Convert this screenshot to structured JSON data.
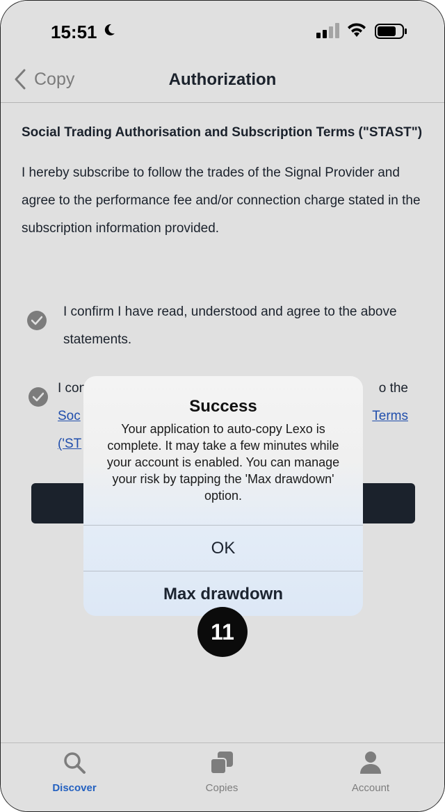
{
  "status_bar": {
    "time": "15:51"
  },
  "nav": {
    "back_label": "Copy",
    "title": "Authorization"
  },
  "content": {
    "heading": "Social Trading Authorisation and Subscription Terms (\"STAST\")",
    "intro": "I hereby subscribe to follow the trades of the Signal Provider and agree to the performance fee and/or connection charge stated in the subscription information provided.",
    "checkbox1_text": "I confirm I have read, understood and agree to the above statements.",
    "checkbox2_line1_start": "I con",
    "checkbox2_line1_end": "o the",
    "checkbox2_link_start": "Soc",
    "checkbox2_link_end": "Terms",
    "checkbox2_line3_start": "('ST"
  },
  "modal": {
    "title": "Success",
    "message": "Your application to auto-copy Lexo is complete. It may take a few minutes while your account is enabled. You can manage your risk by tapping the 'Max drawdown' option.",
    "ok_label": "OK",
    "max_drawdown_label": "Max drawdown"
  },
  "step_badge": "11",
  "tabbar": {
    "tabs": [
      {
        "label": "Discover",
        "icon": "search-icon",
        "active": true
      },
      {
        "label": "Copies",
        "icon": "copies-icon",
        "active": false
      },
      {
        "label": "Account",
        "icon": "person-icon",
        "active": false
      }
    ]
  },
  "colors": {
    "accent": "#2a6fdb",
    "link": "#2559c4",
    "dark": "#1f2733"
  }
}
